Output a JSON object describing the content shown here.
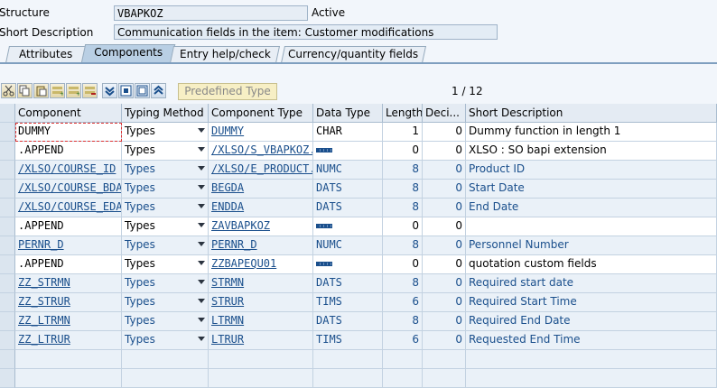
{
  "header": {
    "structure_label": "Structure",
    "structure_value": "VBAPKOZ",
    "status": "Active",
    "short_desc_label": "Short Description",
    "short_desc_value": "Communication fields in the item: Customer modifications"
  },
  "tabs": [
    {
      "label": "Attributes"
    },
    {
      "label": "Components"
    },
    {
      "label": "Entry help/check"
    },
    {
      "label": "Currency/quantity fields"
    }
  ],
  "toolbar": {
    "predefined_type_label": "Predefined Type",
    "pager": "1 / 12"
  },
  "table": {
    "columns": [
      "Component",
      "Typing Method",
      "Component Type",
      "Data Type",
      "Length",
      "Deci...",
      "Short Description"
    ],
    "rows": [
      {
        "component": "DUMMY",
        "typing": "Types",
        "ctype": "DUMMY",
        "dtype": "CHAR",
        "length": "1",
        "dec": "0",
        "desc": "Dummy function in length 1"
      },
      {
        "component": ".APPEND",
        "typing": "Types",
        "ctype": "/XLSO/S_VBAPKOZ...",
        "dtype": "",
        "length": "0",
        "dec": "0",
        "desc": "XLSO : SO bapi extension"
      },
      {
        "component": "/XLSO/COURSE_ID",
        "typing": "Types",
        "ctype": "/XLSO/E_PRODUCT...",
        "dtype": "NUMC",
        "length": "8",
        "dec": "0",
        "desc": "Product ID"
      },
      {
        "component": "/XLSO/COURSE_BDA",
        "typing": "Types",
        "ctype": "BEGDA",
        "dtype": "DATS",
        "length": "8",
        "dec": "0",
        "desc": "Start Date"
      },
      {
        "component": "/XLSO/COURSE_EDA",
        "typing": "Types",
        "ctype": "ENDDA",
        "dtype": "DATS",
        "length": "8",
        "dec": "0",
        "desc": "End Date"
      },
      {
        "component": ".APPEND",
        "typing": "Types",
        "ctype": "ZAVBAPKOZ",
        "dtype": "",
        "length": "0",
        "dec": "0",
        "desc": ""
      },
      {
        "component": "PERNR_D",
        "typing": "Types",
        "ctype": "PERNR_D",
        "dtype": "NUMC",
        "length": "8",
        "dec": "0",
        "desc": "Personnel Number"
      },
      {
        "component": ".APPEND",
        "typing": "Types",
        "ctype": "ZZBAPEQU01",
        "dtype": "",
        "length": "0",
        "dec": "0",
        "desc": "quotation custom fields"
      },
      {
        "component": "ZZ_STRMN",
        "typing": "Types",
        "ctype": "STRMN",
        "dtype": "DATS",
        "length": "8",
        "dec": "0",
        "desc": "Required start date"
      },
      {
        "component": "ZZ_STRUR",
        "typing": "Types",
        "ctype": "STRUR",
        "dtype": "TIMS",
        "length": "6",
        "dec": "0",
        "desc": "Required Start Time"
      },
      {
        "component": "ZZ_LTRMN",
        "typing": "Types",
        "ctype": "LTRMN",
        "dtype": "DATS",
        "length": "8",
        "dec": "0",
        "desc": "Required End Date"
      },
      {
        "component": "ZZ_LTRUR",
        "typing": "Types",
        "ctype": "LTRUR",
        "dtype": "TIMS",
        "length": "6",
        "dec": "0",
        "desc": "Requested End Time"
      }
    ]
  },
  "colors": {
    "accent": "#1a4f8c",
    "tab_active": "#b9cfe4",
    "grid_bg": "#e9f0f7"
  }
}
